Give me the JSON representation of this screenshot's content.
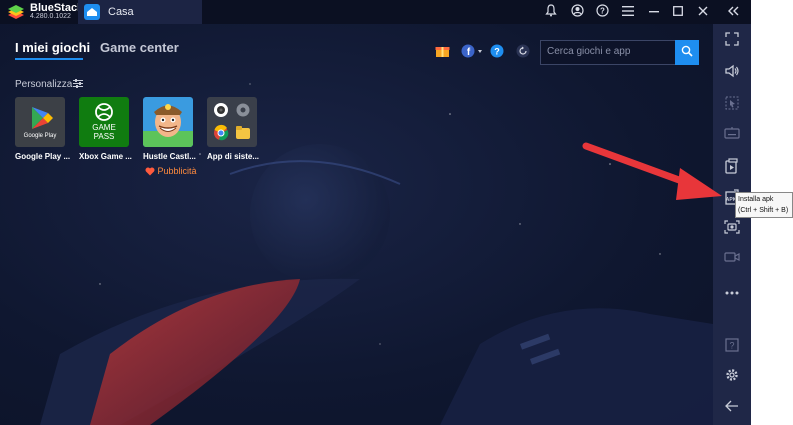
{
  "titlebar": {
    "brand": "BlueStacks",
    "version": "4.280.0.1022",
    "tab_label": "Casa"
  },
  "nav": {
    "my_games": "I miei giochi",
    "game_center": "Game center"
  },
  "section": {
    "label": "Personalizza"
  },
  "search": {
    "placeholder": "Cerca giochi e app"
  },
  "games": [
    {
      "label": "Google Play ...",
      "tile_text": "Google Play"
    },
    {
      "label": "Xbox Game ...",
      "tile_text_1": "GAME",
      "tile_text_2": "PASS"
    },
    {
      "label": "Hustle Castl..."
    },
    {
      "label": "App di siste..."
    }
  ],
  "ad": {
    "label": "Pubblicità"
  },
  "tooltip": {
    "line1": "Installa apk",
    "line2": "(Ctrl + Shift + B)"
  },
  "colors": {
    "accent": "#1e8ef0",
    "background": "#0f1730",
    "sidebar": "#1f2747",
    "arrow": "#e8363a",
    "ad": "#ff8a3d"
  }
}
